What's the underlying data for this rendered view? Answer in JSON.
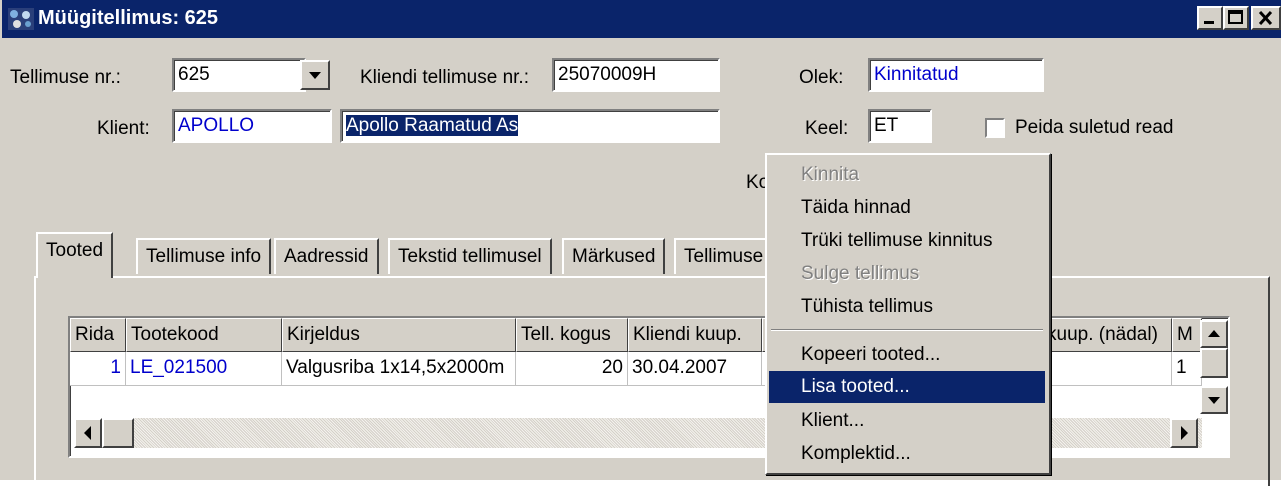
{
  "window": {
    "title": "Müügitellimus: 625"
  },
  "header": {
    "order_no_label": "Tellimuse nr.:",
    "order_no_value": "625",
    "client_order_label": "Kliendi tellimuse nr.:",
    "client_order_value": "25070009H",
    "status_label": "Olek:",
    "status_value": "Kinnitatud",
    "client_label": "Klient:",
    "client_code": "APOLLO",
    "client_name": "Apollo Raamatud As",
    "language_label": "Keel:",
    "language_value": "ET",
    "hide_closed_label": "Peida suletud read",
    "hide_closed_checked": false,
    "partial_label": "Ko"
  },
  "tabs": [
    {
      "label": "Tooted",
      "active": true
    },
    {
      "label": "Tellimuse info"
    },
    {
      "label": "Aadressid"
    },
    {
      "label": "Tekstid tellimusel"
    },
    {
      "label": "Märkused"
    },
    {
      "label": "Tellimuse"
    }
  ],
  "grid": {
    "headers": [
      "Rida",
      "Tootekood",
      "Kirjeldus",
      "Tell. kogus",
      "Kliendi kuup.",
      "kuup. (nädal)",
      "M"
    ],
    "rows": [
      {
        "rida": "1",
        "tootekood": "LE_021500",
        "kirjeldus": "Valgusriba 1x14,5x2000m",
        "kogus": "20",
        "kuup": "30.04.2007",
        "last": "1"
      }
    ]
  },
  "context_menu": {
    "items": [
      {
        "label": "Kinnita",
        "disabled": true
      },
      {
        "label": "Täida hinnad"
      },
      {
        "label": "Trüki tellimuse kinnitus"
      },
      {
        "label": "Sulge tellimus",
        "disabled": true
      },
      {
        "label": "Tühista tellimus"
      },
      {
        "separator": true
      },
      {
        "label": "Kopeeri tooted..."
      },
      {
        "label": "Lisa tooted...",
        "highlighted": true
      },
      {
        "label": "Klient..."
      },
      {
        "label": "Komplektid..."
      }
    ]
  },
  "colors": {
    "titlebar": "#0a246a",
    "face": "#d4d0c8",
    "link_text": "#0000cc",
    "highlight": "#0a246a"
  }
}
